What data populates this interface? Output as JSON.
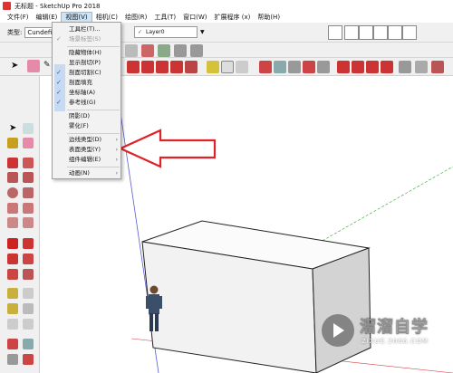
{
  "window": {
    "title": "无标题 - SketchUp Pro 2018"
  },
  "menubar": {
    "items": [
      "文件(F)",
      "编辑(E)",
      "视图(V)",
      "相机(C)",
      "绘图(R)",
      "工具(T)",
      "窗口(W)",
      "扩展程序 (x)",
      "帮助(H)"
    ]
  },
  "toolbar": {
    "type_label": "类型:",
    "type_value": "Cundefi",
    "layer_value": "Layer0"
  },
  "view_menu": {
    "items": [
      {
        "label": "工具栏(T)...",
        "checked": false,
        "disabled": false,
        "submenu": false
      },
      {
        "label": "场景标签(S)",
        "checked": true,
        "disabled": true,
        "submenu": false
      },
      {
        "label": "隐藏物体(H)",
        "checked": false,
        "disabled": false,
        "submenu": false
      },
      {
        "label": "显示剖切(P)",
        "checked": false,
        "disabled": false,
        "submenu": false
      },
      {
        "label": "剖面切割(C)",
        "checked": true,
        "disabled": false,
        "submenu": false
      },
      {
        "label": "剖面填充",
        "checked": true,
        "disabled": false,
        "submenu": false
      },
      {
        "label": "坐标轴(A)",
        "checked": true,
        "disabled": false,
        "submenu": false
      },
      {
        "label": "参考线(G)",
        "checked": true,
        "disabled": false,
        "submenu": false
      },
      {
        "label": "阴影(D)",
        "checked": false,
        "disabled": false,
        "submenu": false
      },
      {
        "label": "雾化(F)",
        "checked": false,
        "disabled": false,
        "submenu": false
      },
      {
        "label": "边线类型(D)",
        "checked": false,
        "disabled": false,
        "submenu": true
      },
      {
        "label": "表面类型(Y)",
        "checked": false,
        "disabled": false,
        "submenu": true
      },
      {
        "label": "组件编辑(E)",
        "checked": false,
        "disabled": false,
        "submenu": true
      },
      {
        "label": "动画(N)",
        "checked": false,
        "disabled": false,
        "submenu": true
      }
    ]
  },
  "watermark": {
    "name": "溜溜自学",
    "url": "ZIXUE.3066.COM"
  },
  "colors": {
    "arrow": "#e0222a",
    "box_fill": "#f2f2f2",
    "accent": "#1b63c8"
  }
}
